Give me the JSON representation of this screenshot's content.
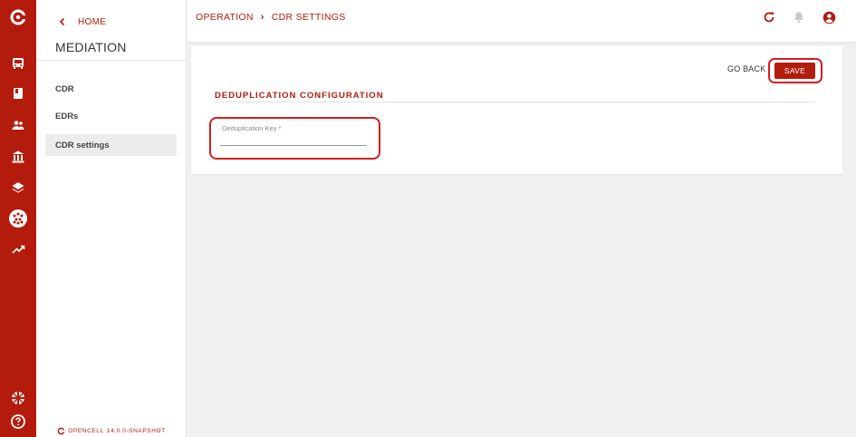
{
  "rail": {
    "icons": [
      "opencell-logo-icon",
      "bus-icon",
      "book-icon",
      "users-icon",
      "bank-icon",
      "layers-icon",
      "mediation-icon",
      "trending-up-icon",
      "language-flag-icon",
      "help-icon"
    ]
  },
  "sidebar": {
    "home_label": "HOME",
    "title": "MEDIATION",
    "items": [
      {
        "label": "CDR",
        "active": false
      },
      {
        "label": "EDRs",
        "active": false
      },
      {
        "label": "CDR settings",
        "active": true
      }
    ],
    "version_brand": "OPENCELL",
    "version_number": "14.0.0-SNAPSHOT"
  },
  "header": {
    "breadcrumbs": [
      "OPERATION",
      "CDR SETTINGS"
    ],
    "icons": [
      "refresh-icon",
      "bell-icon",
      "account-icon"
    ]
  },
  "card": {
    "go_back_label": "GO BACK",
    "save_label": "SAVE",
    "section_title": "DEDUPLICATION CONFIGURATION",
    "field": {
      "label": "Deduplication Key *",
      "value": ""
    }
  },
  "colors": {
    "brand": "#b31b0c",
    "highlight": "#d31f1f",
    "background": "#f1f1f1"
  }
}
